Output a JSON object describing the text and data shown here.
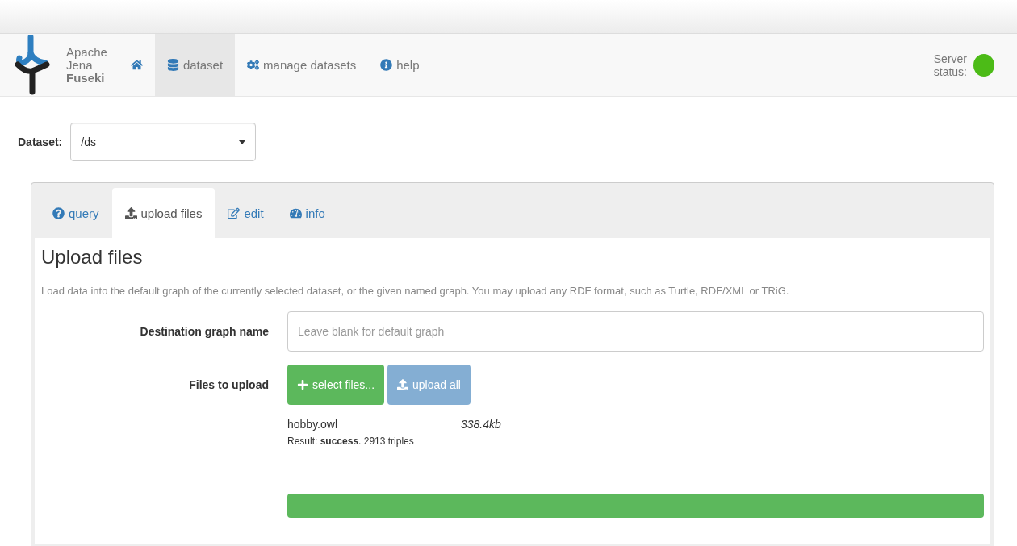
{
  "navbar": {
    "brand": {
      "line_1": "Apache",
      "line_2": "Jena",
      "line_3": "Fuseki"
    },
    "items": [
      {
        "kind": "icon",
        "selected": false
      },
      {
        "kind": "link",
        "label": "dataset",
        "selected": true
      },
      {
        "kind": "link",
        "label": "manage datasets",
        "selected": false
      },
      {
        "kind": "link",
        "label": "help",
        "selected": false
      }
    ],
    "server_status": {
      "label_1": "Server",
      "label_2": "status:",
      "color": "#4cbb17"
    }
  },
  "dataset_selector": {
    "label": "Dataset:",
    "value": "/ds"
  },
  "tabs": [
    {
      "label": "query",
      "selected": false
    },
    {
      "label": "upload files",
      "selected": true
    },
    {
      "label": "edit",
      "selected": false
    },
    {
      "label": "info",
      "selected": false
    }
  ],
  "upload": {
    "title": "Upload files",
    "description": "Load data into the default graph of the currently selected dataset, or the given named graph. You may upload any RDF format, such as Turtle, RDF/XML or TRiG.",
    "destination": {
      "label": "Destination graph name",
      "placeholder": "Leave blank for default graph"
    },
    "files_label": "Files to upload",
    "buttons": [
      {
        "kind": "select",
        "label": "select files...",
        "disabled": false
      },
      {
        "kind": "upload",
        "label": "upload all",
        "disabled": true
      }
    ],
    "files": [
      {
        "name": "hobby.owl",
        "size": "338.4kb",
        "result": "Result: **success**. 2913 triples",
        "level": 1
      }
    ]
  }
}
